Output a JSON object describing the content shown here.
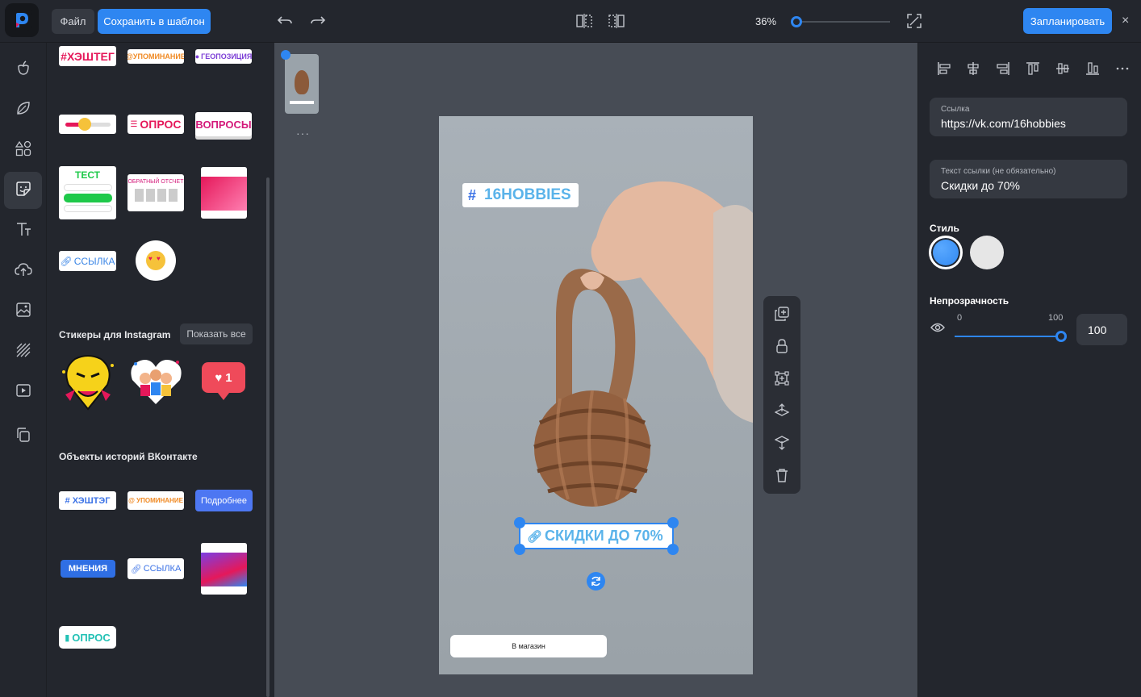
{
  "app": {
    "logo": "logo-icon"
  },
  "topbar": {
    "file_label": "Файл",
    "save_template_label": "Сохранить в шаблон",
    "zoom_label": "36%",
    "zoom_value": 36,
    "schedule_label": "Запланировать",
    "close_label": "×"
  },
  "rail": {
    "items": [
      {
        "icon": "apple-icon"
      },
      {
        "icon": "leaf-icon"
      },
      {
        "icon": "shapes-icon"
      },
      {
        "icon": "sticker-icon",
        "active": true
      },
      {
        "icon": "text-icon"
      },
      {
        "icon": "upload-icon"
      },
      {
        "icon": "image-icon"
      },
      {
        "icon": "pattern-icon"
      },
      {
        "icon": "video-icon"
      },
      {
        "icon": "copy-icon"
      }
    ]
  },
  "stickers": {
    "hashtag": "#ХЭШТЕГ",
    "mention": "@УПОМИНАНИЕ",
    "geo": "ГЕОПОЗИЦИЯ",
    "poll": "ОПРОС",
    "questions": "ВОПРОСЫ",
    "quiz": "ТЕСТ",
    "countdown": "ОБРАТНЫЙ ОТСЧЕТ",
    "link": "ССЫЛКА"
  },
  "instagram_section": {
    "title": "Стикеры для Instagram",
    "show_all": "Показать все",
    "like_count": "1"
  },
  "vk_section": {
    "title": "Объекты историй ВКонтакте",
    "hashtag": "# ХЭШТЭГ",
    "mention": "@ УПОМИНАНИЕ",
    "more": "Подробнее",
    "opinions": "МНЕНИЯ",
    "link": "ССЫЛКА",
    "poll": "ОПРОС"
  },
  "canvas": {
    "thumb_more": "···",
    "hashtag_text": "16HOBBIES",
    "hashtag_symbol": "#",
    "link_sticker_text": "СКИДКИ ДО 70%",
    "shop_button": "В магазин"
  },
  "right_panel": {
    "link_label": "Ссылка",
    "link_value": "https://vk.com/16hobbies",
    "link_text_label": "Текст ссылки (не обязательно)",
    "link_text_value": "Скидки до 70%",
    "style_title": "Стиль",
    "style_colors": [
      "#2e86f1",
      "#e6e6e6"
    ],
    "opacity_title": "Непрозрачность",
    "opacity_min": "0",
    "opacity_max": "100",
    "opacity_value": "100"
  },
  "colors": {
    "accent": "#2e86f1",
    "pink": "#e5185a",
    "orange": "#f08a24",
    "purple": "#7c3fd6"
  }
}
